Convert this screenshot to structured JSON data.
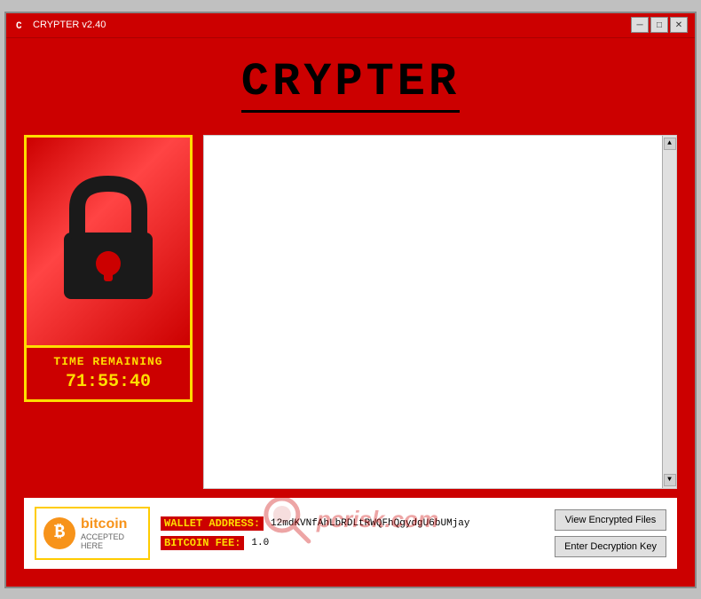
{
  "titlebar": {
    "title": "CRYPTER v2.40",
    "min_btn": "─",
    "max_btn": "□",
    "close_btn": "✕"
  },
  "app": {
    "title": "CRYPTER"
  },
  "timer": {
    "label": "TIME REMAINING",
    "value": "71:55:40"
  },
  "textarea": {
    "content": ""
  },
  "bitcoin": {
    "symbol": "₿",
    "text": "bitcoin",
    "subtext": "ACCEPTED HERE"
  },
  "wallet": {
    "address_label": "WALLET ADDRESS:",
    "address_value": "12mdKVNfAhLbRDLtRWQFhQgydgU6bUMjay",
    "fee_label": "BITCOIN FEE:",
    "fee_value": "1.0"
  },
  "buttons": {
    "view_encrypted": "View Encrypted Files",
    "enter_key": "Enter Decryption Key"
  },
  "watermark": {
    "site": "pcrisk.com"
  }
}
